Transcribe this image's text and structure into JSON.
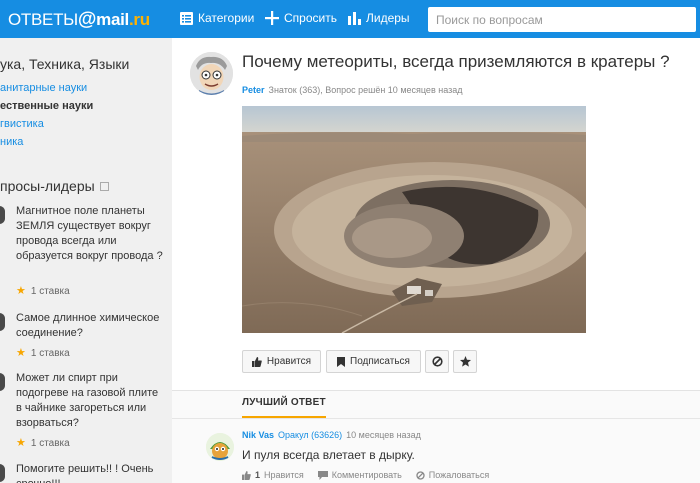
{
  "header": {
    "logo_prefix": "ОТВЕТЫ",
    "logo_at": "@",
    "logo_mail": "mail",
    "logo_ru": ".ru",
    "nav": {
      "categories": "Категории",
      "ask": "Спросить",
      "leaders": "Лидеры"
    },
    "search_placeholder": "Поиск по вопросам"
  },
  "sidebar": {
    "category_title": "ука, Техника, Языки",
    "links": [
      "анитарные науки",
      "ественные науки",
      "гвистика",
      "ника"
    ],
    "active_link_index": 1,
    "leaders_title": "просы-лидеры",
    "questions": [
      {
        "text": "Магнитное поле планеты ЗЕМЛЯ существует вокруг провода всегда или образуется вокруг провода ?",
        "meta": "1 ставка"
      },
      {
        "text": "Самое длинное химическое соединение?",
        "meta": "1 ставка"
      },
      {
        "text": "Может ли спирт при подогреве на газовой плите в чайнике загореться или взорваться?",
        "meta": "1 ставка"
      },
      {
        "text": "Помогите решить!! ! Очень срочно!!!",
        "meta": ""
      }
    ]
  },
  "question": {
    "title": "Почему метеориты, всегда приземляются в кратеры ?",
    "author_name": "Peter",
    "author_meta": "Знаток (363), Вопрос решён 10 месяцев назад",
    "actions": {
      "like": "Нравится",
      "subscribe": "Подписаться"
    }
  },
  "best_answer": {
    "label": "ЛУЧШИЙ ОТВЕТ",
    "author_name": "Nik Vas",
    "author_rank": "Оракул (63626)",
    "time": "10 месяцев назад",
    "text": "И пуля всегда влетает в дырку.",
    "likes_count": "1",
    "like_label": "Нравится",
    "comment_label": "Комментировать",
    "report_label": "Пожаловаться"
  },
  "colors": {
    "brand": "#168de2",
    "accent": "#f7a600"
  }
}
